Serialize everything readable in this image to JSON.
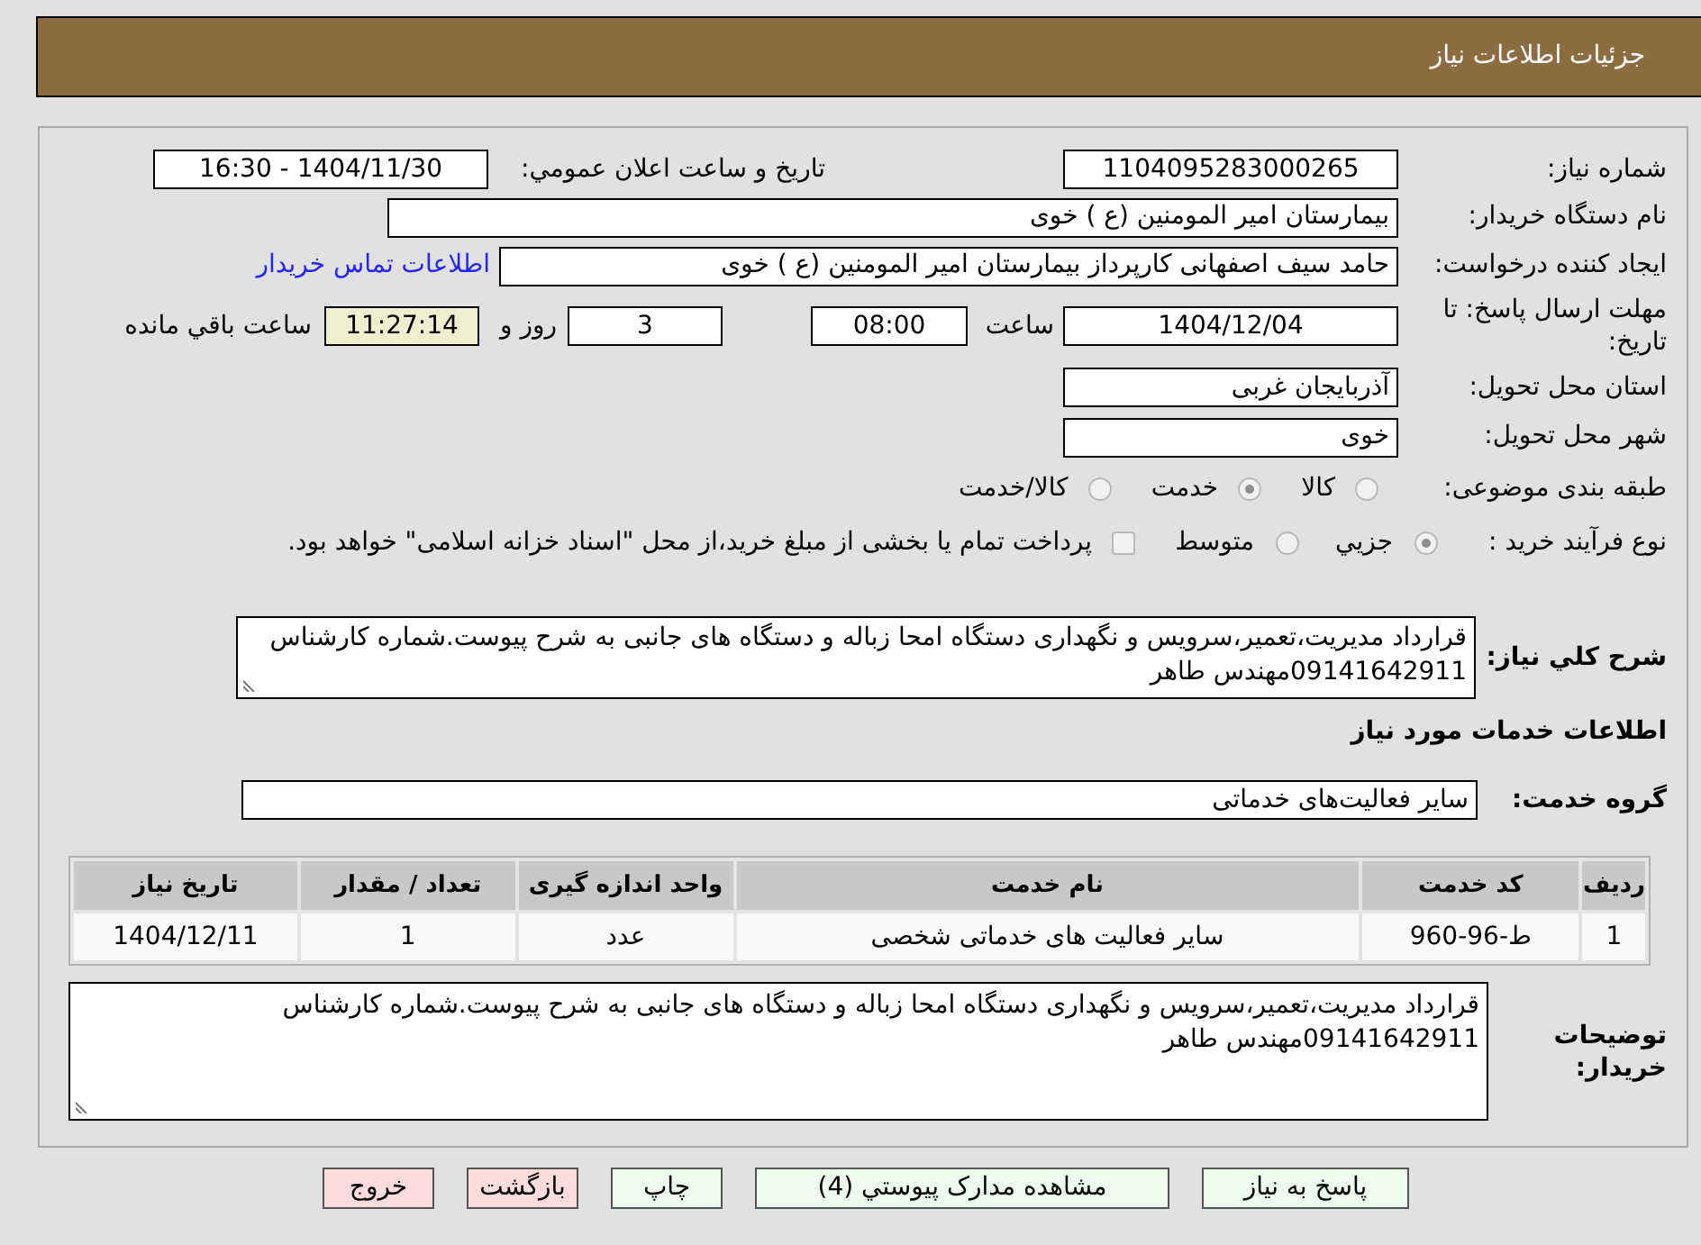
{
  "header": {
    "title": "جزئیات اطلاعات نیاز"
  },
  "need_number": {
    "label": "شماره نیاز:",
    "value": "1104095283000265"
  },
  "announcement": {
    "label": "تاریخ و ساعت اعلان عمومي:",
    "value": "1404/11/30 - 16:30"
  },
  "buyer_org": {
    "label": "نام دستگاه خریدار:",
    "value": "بیمارستان امیر المومنین (ع ) خوی"
  },
  "requester": {
    "label": "ایجاد کننده درخواست:",
    "value": "حامد سیف اصفهانی کارپرداز بیمارستان امیر المومنین (ع ) خوی",
    "contact_link": "اطلاعات تماس خریدار"
  },
  "deadline": {
    "label": "مهلت ارسال پاسخ: تا تاریخ:",
    "date": "1404/12/04",
    "time_label": "ساعت",
    "time": "08:00",
    "days": "3",
    "days_label": "روز و",
    "remaining": "11:27:14",
    "remaining_label": "ساعت باقي مانده"
  },
  "province": {
    "label": "استان محل تحویل:",
    "value": "آذربایجان غربی"
  },
  "city": {
    "label": "شهر محل تحویل:",
    "value": "خوی"
  },
  "category": {
    "label": "طبقه بندی موضوعی:",
    "disabled": true,
    "options": [
      {
        "label": "کالا",
        "selected": false
      },
      {
        "label": "خدمت",
        "selected": true
      },
      {
        "label": "کالا/خدمت",
        "selected": false
      }
    ]
  },
  "purchase_type": {
    "label": "نوع فرآیند خرید :",
    "disabled": true,
    "options": [
      {
        "label": "جزيي",
        "selected": true
      },
      {
        "label": "متوسط",
        "selected": false
      }
    ],
    "treasury": {
      "label": "پرداخت تمام یا بخشی از مبلغ خرید،از محل \"اسناد خزانه اسلامی\" خواهد بود.",
      "checked": false
    }
  },
  "description": {
    "label": "شرح کلي نیاز:",
    "value": "قرارداد مدیریت،تعمیر،سرویس و نگهداری دستگاه امحا زباله و دستگاه های جانبی به شرح پیوست.شماره کارشناس 09141642911مهندس طاهر"
  },
  "services_heading": "اطلاعات خدمات مورد نیاز",
  "service_group": {
    "label": "گروه خدمت:",
    "value": "سایر فعالیت‌های خدماتی"
  },
  "table": {
    "columns": [
      "ردیف",
      "کد خدمت",
      "نام خدمت",
      "واحد اندازه گیری",
      "تعداد / مقدار",
      "تاریخ نیاز"
    ],
    "rows": [
      [
        "1",
        "ط-96-960",
        "سایر فعالیت های خدماتی شخصی",
        "عدد",
        "1",
        "1404/12/11"
      ]
    ]
  },
  "buyer_notes": {
    "label": "توضیحات خریدار:",
    "value": "قرارداد مدیریت،تعمیر،سرویس و نگهداری دستگاه امحا زباله و دستگاه های جانبی به شرح پیوست.شماره کارشناس 09141642911مهندس طاهر"
  },
  "buttons": [
    {
      "label": "پاسخ به نیاز",
      "kind": "proceed"
    },
    {
      "label": "مشاهده مدارک پیوستي (4)",
      "kind": "proceed"
    },
    {
      "label": "چاپ",
      "kind": "proceed"
    },
    {
      "label": "بازگشت",
      "kind": "leave"
    },
    {
      "label": "خروج",
      "kind": "leave"
    }
  ]
}
